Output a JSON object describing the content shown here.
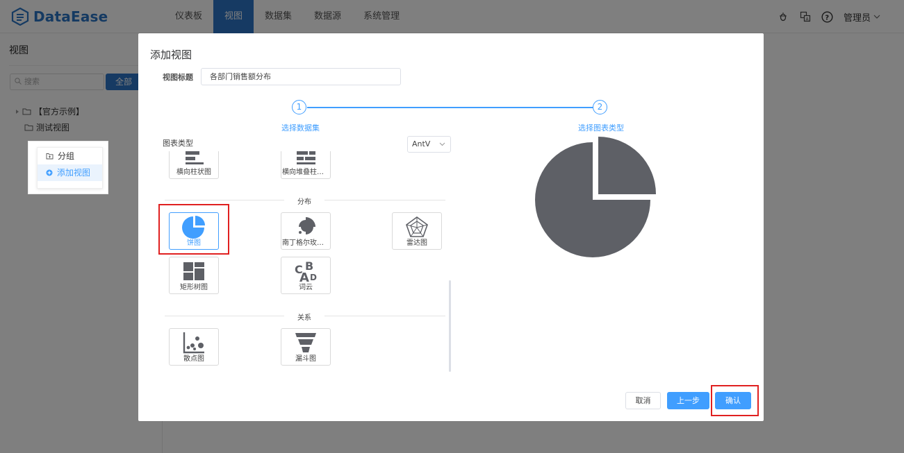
{
  "app": {
    "brand": "DataEase",
    "nav": [
      "仪表板",
      "视图",
      "数据集",
      "数据源",
      "系统管理"
    ],
    "nav_active_index": 1,
    "user": "管理员"
  },
  "sidebar": {
    "title": "视图",
    "search_placeholder": "搜索",
    "filter_label": "全部",
    "tree": [
      "【官方示例】",
      "测试视图"
    ],
    "menu": [
      "分组",
      "添加视图"
    ]
  },
  "dialog": {
    "title": "添加视图",
    "view_title_label": "视图标题",
    "view_title_value": "各部门销售额分布",
    "steps": [
      {
        "number": "1",
        "label": "选择数据集"
      },
      {
        "number": "2",
        "label": "选择图表类型"
      }
    ],
    "chart_type_label": "图表类型",
    "chart_lib": "AntV",
    "groups": {
      "distribution": "分布",
      "relation": "关系"
    },
    "tiles": {
      "hbar": "横向柱状图",
      "hbar_stack": "横向堆叠柱状图",
      "pie": "饼图",
      "rose": "南丁格尔玫瑰图",
      "radar": "雷达图",
      "treemap": "矩形树图",
      "wordcloud": "词云",
      "scatter": "散点图",
      "funnel": "漏斗图"
    },
    "selected_tile": "pie",
    "buttons": {
      "cancel": "取消",
      "prev": "上一步",
      "confirm": "确认"
    }
  },
  "colors": {
    "brand": "#2d75c6",
    "accent": "#409eff",
    "icon_gray": "#5e6066",
    "highlight": "#e02020"
  }
}
